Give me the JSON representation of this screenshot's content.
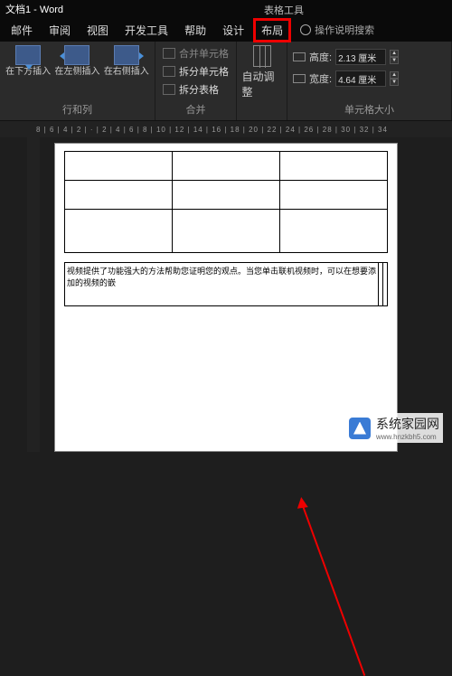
{
  "title": {
    "doc": "文档1 - Word",
    "context": "表格工具"
  },
  "tabs": {
    "mail": "邮件",
    "review": "审阅",
    "view": "视图",
    "dev": "开发工具",
    "help": "帮助",
    "design": "设计",
    "layout": "布局",
    "tell": "操作说明搜索"
  },
  "ribbon": {
    "rows_cols": {
      "insert_below": "在下方插入",
      "insert_left": "在左侧插入",
      "insert_right": "在右侧插入",
      "label": "行和列"
    },
    "merge": {
      "merge_cells": "合并单元格",
      "split_cells": "拆分单元格",
      "split_table": "拆分表格",
      "label": "合并"
    },
    "autofit": {
      "label": "自动调整"
    },
    "size": {
      "height_label": "高度:",
      "height_value": "2.13 厘米",
      "width_label": "宽度:",
      "width_value": "4.64 厘米",
      "label": "单元格大小"
    }
  },
  "ruler": "8  |  6  |  4  |  2  |  ·  |  2  |  4  |  6  |  8  | 10 | 12 | 14 | 16 | 18 | 20 | 22 | 24 | 26 | 28 | 30 | 32 | 34",
  "doc": {
    "para1": "视频提供了功能强大的方法帮助您证明您的观点。当您单击联机视频时，可以在想要添加的视频的嵌"
  },
  "watermark": {
    "name": "系统家园网",
    "url": "www.hnzkbh5.com"
  }
}
